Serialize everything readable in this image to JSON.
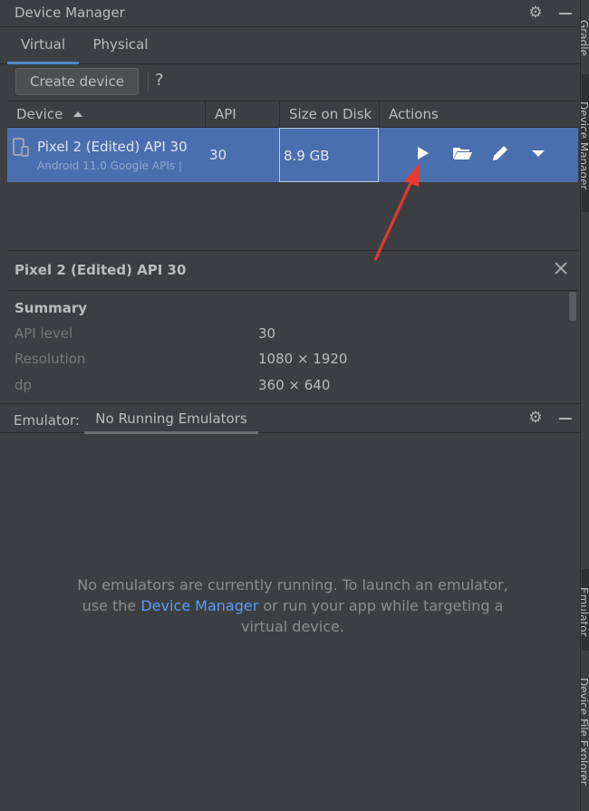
{
  "header": {
    "title": "Device Manager",
    "icons": [
      "gear-icon",
      "minimize-icon"
    ]
  },
  "tabs": [
    {
      "label": "Virtual",
      "active": true
    },
    {
      "label": "Physical",
      "active": false
    }
  ],
  "toolbar": {
    "create_label": "Create device",
    "help_label": "?"
  },
  "table": {
    "columns": [
      "Device",
      "API",
      "Size on Disk",
      "Actions"
    ],
    "sort": {
      "column": "Device",
      "direction": "ascending"
    },
    "rows": [
      {
        "name": "Pixel 2 (Edited) API 30",
        "subtitle": "Android 11.0 Google APIs |",
        "api": "30",
        "size": "8.9 GB",
        "actions": [
          "play-icon",
          "folder-icon",
          "pencil-icon",
          "dropdown-arrow-icon"
        ]
      }
    ]
  },
  "details": {
    "title": "Pixel 2 (Edited) API 30",
    "section": "Summary",
    "items": [
      {
        "key": "API level",
        "value": "30"
      },
      {
        "key": "Resolution",
        "value": "1080 × 1920"
      },
      {
        "key": "dp",
        "value": "360 × 640"
      }
    ]
  },
  "emulator": {
    "label": "Emulator:",
    "tab": "No Running Emulators",
    "message_before": "No emulators are currently running. To launch an emulator, use the",
    "message_link": "Device Manager",
    "message_after": "or run your app while targeting a virtual device."
  },
  "side_tabs": [
    "Gradle",
    "Device Manager",
    "Emulator",
    "Device File Explorer"
  ],
  "colors": {
    "selection": "#4b6eaf",
    "tab_accent": "#4a88c7",
    "link": "#589df6",
    "annotation_arrow": "#e8392f"
  }
}
